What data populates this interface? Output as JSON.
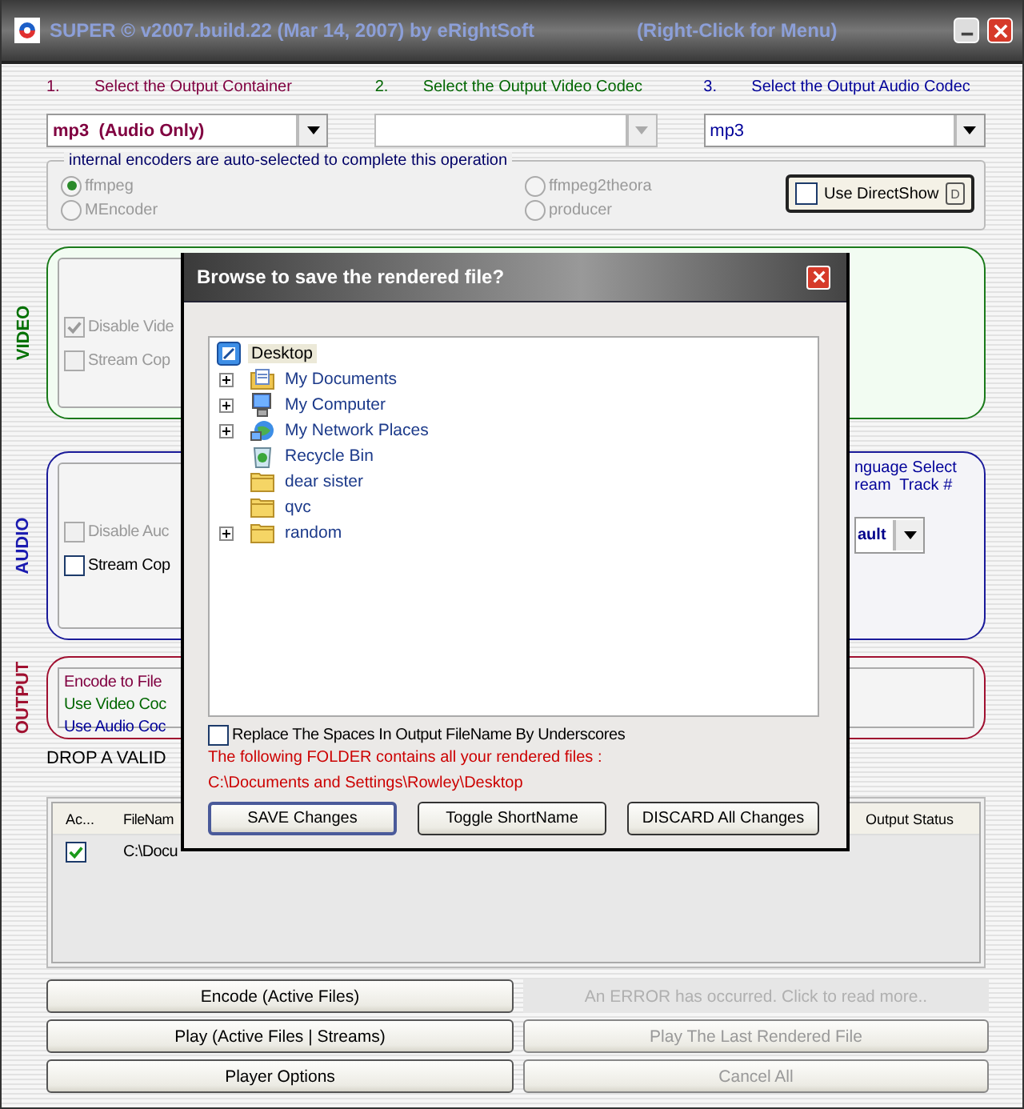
{
  "window": {
    "title": "SUPER © v2007.build.22 (Mar 14, 2007) by eRightSoft",
    "hint": "(Right-Click for Menu)"
  },
  "steps": [
    {
      "number": "1.",
      "label": "Select the Output Container",
      "value": "mp3  (Audio Only)",
      "disabled": false,
      "color": "#800040"
    },
    {
      "number": "2.",
      "label": "Select the Output Video Codec",
      "disabled": true,
      "color": "#006600"
    },
    {
      "number": "3.",
      "label": "Select the Output Audio Codec",
      "value": "mp3",
      "disabled": false,
      "color": "#000099"
    }
  ],
  "encoders": {
    "legend": "internal encoders are auto-selected to complete this operation",
    "disabled": true,
    "options": [
      {
        "label": "ffmpeg",
        "selected": true
      },
      {
        "label": "ffmpeg2theora",
        "selected": false
      },
      {
        "label": "MEncoder",
        "selected": false
      },
      {
        "label": "producer",
        "selected": false
      }
    ]
  },
  "direct_show": {
    "label": "Use DirectShow",
    "checked": false,
    "key": "D"
  },
  "video": {
    "title": "VIDEO",
    "checkboxes": [
      {
        "label": "Disable Vide",
        "checked": true,
        "disabled": true
      },
      {
        "label": "Stream Cop",
        "checked": false,
        "disabled": true
      }
    ]
  },
  "audio": {
    "title": "AUDIO",
    "checkboxes": [
      {
        "label": "Disable Auc",
        "checked": false,
        "disabled": true
      },
      {
        "label": "Stream Cop",
        "checked": false,
        "disabled": false
      }
    ],
    "language_legend": "nguage Select",
    "track_label": "ream  Track #",
    "track_value": "ault"
  },
  "output": {
    "title": "OUTPUT",
    "lines": [
      {
        "text": "Encode to File",
        "color": "#800040"
      },
      {
        "text": "Use Video Coc",
        "color": "#006600"
      },
      {
        "text": "Use Audio Coc",
        "color": "#000099"
      }
    ]
  },
  "drop_hint": "DROP A VALID",
  "table": {
    "columns": [
      "Ac...",
      "FileNam",
      "Output Status"
    ],
    "rows": [
      {
        "active": true,
        "file": "C:\\Docu"
      }
    ]
  },
  "buttons": [
    {
      "label": "Encode (Active Files)",
      "kind": "button",
      "disabled": false
    },
    {
      "label": "An ERROR has occurred. Click to read more..",
      "kind": "notice",
      "disabled": true
    },
    {
      "label": "Play (Active Files | Streams)",
      "kind": "button",
      "disabled": false
    },
    {
      "label": "Play The Last Rendered File",
      "kind": "button",
      "disabled": true
    },
    {
      "label": "Player Options",
      "kind": "button",
      "disabled": false
    },
    {
      "label": "Cancel All",
      "kind": "button",
      "disabled": true
    }
  ],
  "dialog": {
    "title": "Browse to save the rendered file?",
    "tree": {
      "label": "Desktop",
      "kind": "desktop",
      "selected": true,
      "children": [
        {
          "label": "My Documents",
          "kind": "documents",
          "expandable": true,
          "selected": false
        },
        {
          "label": "My Computer",
          "kind": "computer",
          "expandable": true,
          "selected": false
        },
        {
          "label": "My Network Places",
          "kind": "network",
          "expandable": true,
          "selected": false
        },
        {
          "label": "Recycle Bin",
          "kind": "recycle",
          "expandable": false,
          "selected": false
        },
        {
          "label": "dear sister",
          "kind": "folder",
          "expandable": false,
          "selected": false
        },
        {
          "label": "qvc",
          "kind": "folder",
          "expandable": false,
          "selected": false
        },
        {
          "label": "random",
          "kind": "folder",
          "expandable": true,
          "selected": false
        }
      ]
    },
    "replace_spaces": {
      "label": "Replace The Spaces In Output FileName By Underscores",
      "checked": false
    },
    "folder_note": "The following FOLDER contains all your rendered files :",
    "folder_path": "C:\\Documents and Settings\\Rowley\\Desktop",
    "buttons": [
      {
        "label": "SAVE Changes",
        "default": true
      },
      {
        "label": "Toggle ShortName",
        "default": false
      },
      {
        "label": "DISCARD All Changes",
        "default": false
      }
    ]
  }
}
